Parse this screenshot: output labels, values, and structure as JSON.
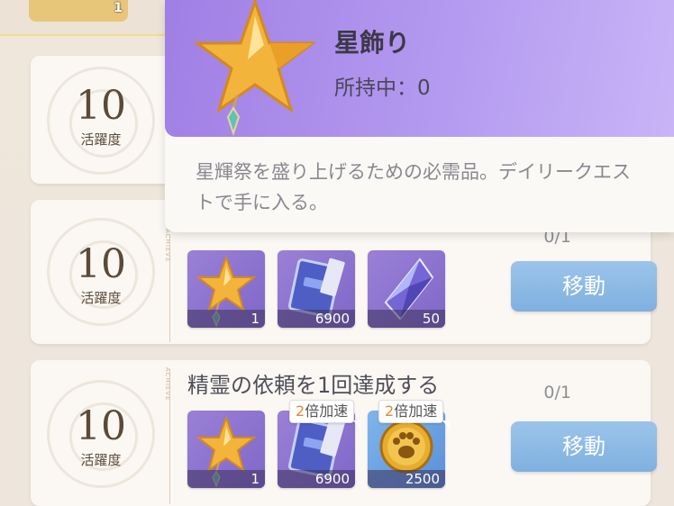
{
  "top_item": {
    "count": "1"
  },
  "cards": [
    {
      "points": "10",
      "points_label": "活躍度"
    },
    {
      "points": "10",
      "points_label": "活躍度",
      "progress": "0/1",
      "vert_text": "ACHIEVE",
      "rewards": [
        {
          "icon": "star-ornament-icon",
          "count": "1"
        },
        {
          "icon": "exp-book-icon",
          "count": "6900"
        },
        {
          "icon": "crystal-icon",
          "count": "50"
        }
      ],
      "button": "移動"
    },
    {
      "points": "10",
      "points_label": "活躍度",
      "title": "精霊の依頼を1回達成する",
      "progress": "0/1",
      "vert_text": "ACHIEVE",
      "rewards": [
        {
          "icon": "star-ornament-icon",
          "count": "1"
        },
        {
          "icon": "exp-book-icon",
          "count": "6900",
          "badge_mult": "2",
          "badge_text": "倍加速"
        },
        {
          "icon": "paw-coin-icon",
          "count": "2500",
          "badge_mult": "2",
          "badge_text": "倍加速"
        }
      ],
      "button": "移動"
    }
  ],
  "tooltip": {
    "title": "星飾り",
    "owned": "所持中：0",
    "description": "星輝祭を盛り上げるための必需品。デイリークエストで手に入る。"
  },
  "colors": {
    "accent_purple": "#a07fe4",
    "button_blue": "#8bb8e4",
    "badge_orange": "#e08a3a"
  }
}
